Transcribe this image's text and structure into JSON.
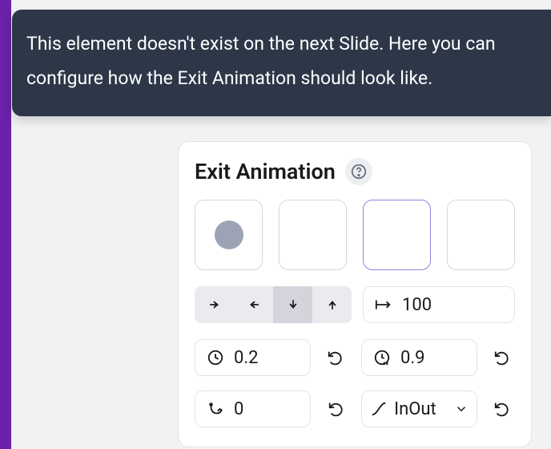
{
  "tooltip": {
    "text": "This element doesn't exist on the next Slide. Here you can configure how the Exit Animation should look like."
  },
  "panel": {
    "title": "Exit Animation",
    "distance": "100",
    "duration": "0.2",
    "delay": "0.9",
    "bounces": "0",
    "easing": "InOut"
  }
}
